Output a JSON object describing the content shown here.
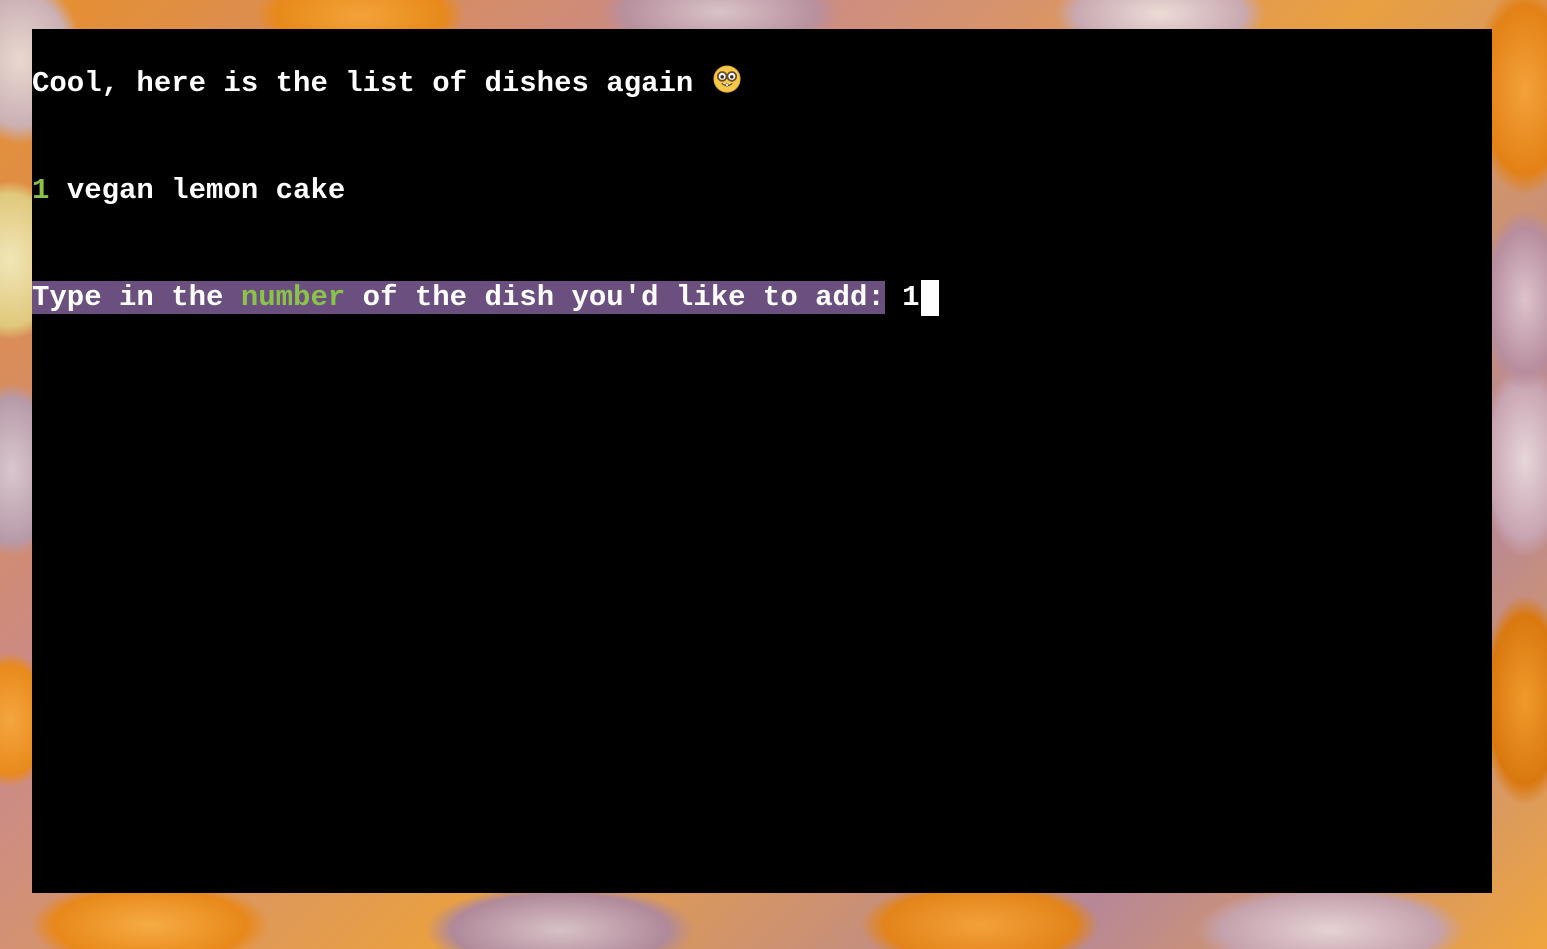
{
  "terminal": {
    "heading": {
      "text": "Cool, here is the list of dishes again",
      "emoji_icon": "nerd-face-icon"
    },
    "dishes": [
      {
        "number": "1",
        "name": "vegan lemon cake"
      }
    ],
    "prompt": {
      "before_highlight": "Type in the ",
      "highlight_word": "number",
      "after_highlight": " of the dish you'd like to add:",
      "input_value": "1"
    }
  },
  "colors": {
    "terminal_background": "#000000",
    "text": "#ffffff",
    "accent_green": "#8bc34a",
    "selection_highlight": "#6b4f7e"
  }
}
